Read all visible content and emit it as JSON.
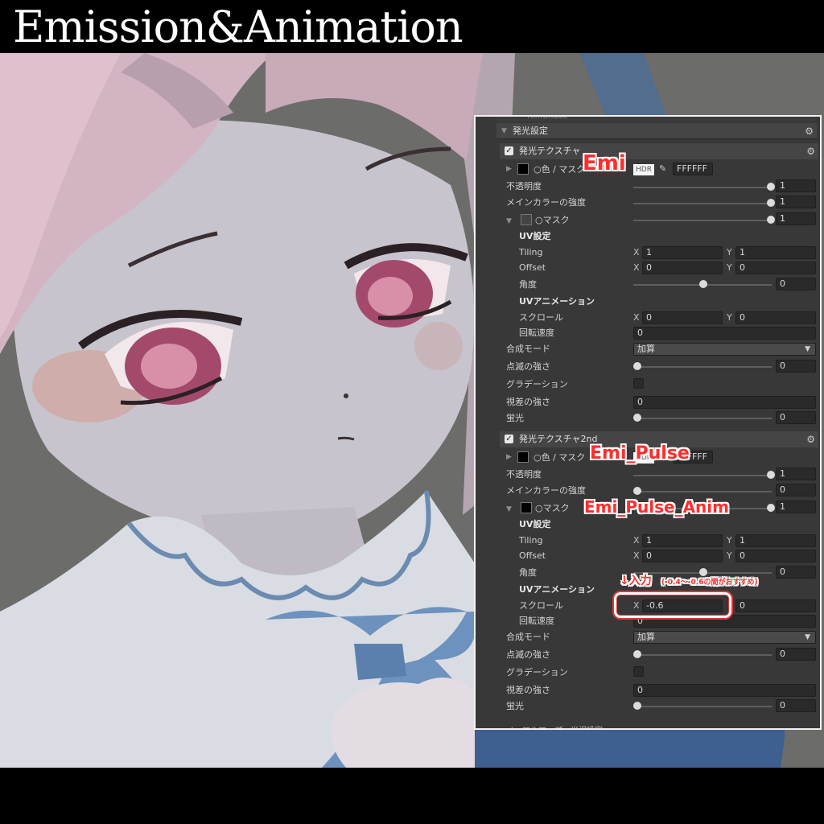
{
  "title": "Emission&Animation",
  "inspector": {
    "cut_header": "RimShade",
    "section_title": "発光設定",
    "emission1": {
      "header": "発光テクスチャ",
      "color_mask_label": "○色 / マスク",
      "hdr_label": "HDR",
      "hex_value": "FFFFFF",
      "opacity_label": "不透明度",
      "opacity_value": "1",
      "main_color_label": "メインカラーの強度",
      "main_color_value": "1",
      "mask_label": "○マスク",
      "mask_value": "1",
      "uv_settings_label": "UV設定",
      "tiling_label": "Tiling",
      "tiling_x": "1",
      "tiling_y": "1",
      "offset_label": "Offset",
      "offset_x": "0",
      "offset_y": "0",
      "angle_label": "角度",
      "angle_value": "0",
      "uv_anim_label": "UVアニメーション",
      "scroll_label": "スクロール",
      "scroll_x": "0",
      "scroll_y": "0",
      "rotation_label": "回転速度",
      "rotation_value": "0",
      "blend_label": "合成モード",
      "blend_value": "加算",
      "blink_label": "点滅の強さ",
      "blink_value": "0",
      "gradation_label": "グラデーション",
      "parallax_label": "視差の強さ",
      "parallax_value": "0",
      "fluorescence_label": "蛍光",
      "fluorescence_value": "0"
    },
    "emission2": {
      "header": "発光テクスチャ2nd",
      "color_mask_label": "○色 / マスク",
      "hdr_label": "HDR",
      "hex_value": "FFFFFF",
      "opacity_label": "不透明度",
      "opacity_value": "1",
      "main_color_label": "メインカラーの強度",
      "main_color_value": "0",
      "mask_label": "○マスク",
      "mask_value": "1",
      "uv_settings_label": "UV設定",
      "tiling_label": "Tiling",
      "tiling_x": "1",
      "tiling_y": "1",
      "offset_label": "Offset",
      "offset_x": "0",
      "offset_y": "0",
      "angle_label": "角度",
      "angle_value": "0",
      "uv_anim_label": "UVアニメーション",
      "scroll_label": "スクロール",
      "scroll_x": "-0.6",
      "scroll_y": "0",
      "rotation_label": "回転速度",
      "rotation_value": "0",
      "blend_label": "合成モード",
      "blend_value": "加算",
      "blink_label": "点滅の強さ",
      "blink_value": "0",
      "gradation_label": "グラデーション",
      "parallax_label": "視差の強さ",
      "parallax_value": "0",
      "fluorescence_label": "蛍光",
      "fluorescence_value": "0"
    },
    "footer_cut": "ノーマルマップ・光沢設定"
  },
  "annotations": {
    "emi": "Emi",
    "emi_pulse": "Emi_Pulse",
    "emi_pulse_anim": "Emi_Pulse_Anim",
    "input_arrow": "↓入力",
    "input_note": "(-0.4～-0.6の間がおすすめ)"
  },
  "colors": {
    "callout_red": "#ff2d2d",
    "panel_bg": "#383838",
    "viewport_bg": "#6a6a68"
  }
}
